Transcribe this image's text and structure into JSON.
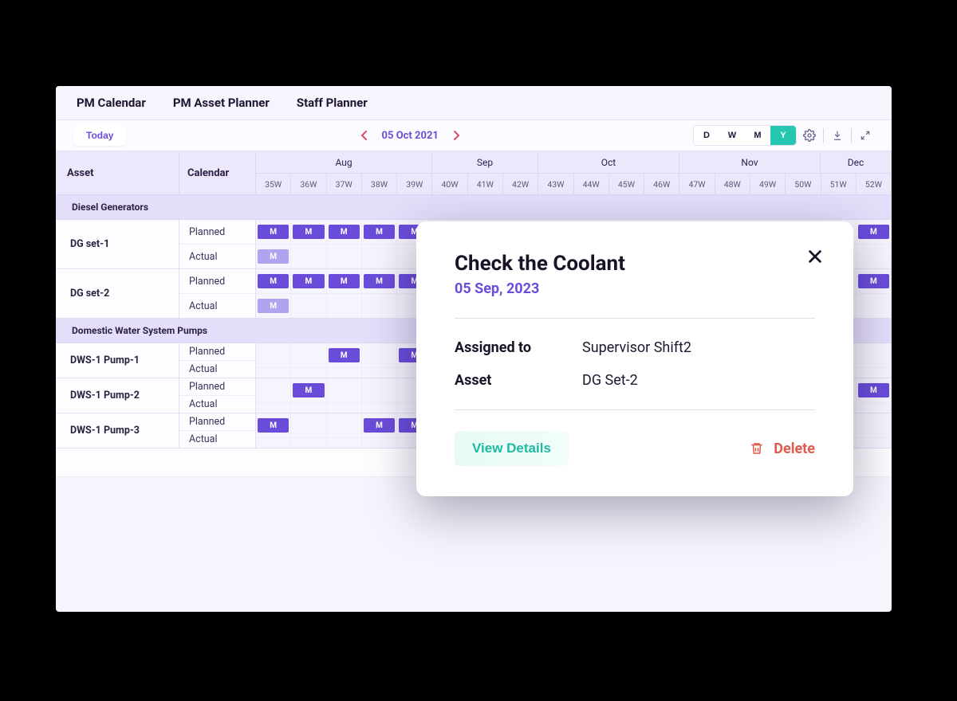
{
  "tabs": [
    {
      "label": "PM Calendar"
    },
    {
      "label": "PM Asset Planner"
    },
    {
      "label": "Staff Planner"
    }
  ],
  "toolbar": {
    "today": "Today",
    "date": "05 Oct 2021",
    "view_d": "D",
    "view_w": "W",
    "view_m": "M",
    "view_y": "Y"
  },
  "header": {
    "asset": "Asset",
    "calendar": "Calendar",
    "months": [
      "Aug",
      "Sep",
      "Oct",
      "Nov",
      "Dec"
    ],
    "weeks": [
      "35W",
      "36W",
      "37W",
      "38W",
      "39W",
      "40W",
      "41W",
      "42W",
      "43W",
      "44W",
      "45W",
      "46W",
      "47W",
      "48W",
      "49W",
      "50W",
      "51W",
      "52W"
    ]
  },
  "chip_label": "M",
  "line_labels": {
    "planned": "Planned",
    "actual": "Actual"
  },
  "groups": [
    {
      "name": "Diesel Generators",
      "assets": [
        {
          "name": "DG set-1",
          "planned": [
            0,
            1,
            2,
            3,
            4,
            17
          ],
          "actual": [
            0
          ]
        },
        {
          "name": "DG set-2",
          "planned": [
            0,
            1,
            2,
            3,
            4,
            17
          ],
          "actual": [
            0
          ]
        }
      ]
    },
    {
      "name": "Domestic Water System Pumps",
      "assets": [
        {
          "name": "DWS-1 Pump-1",
          "planned": [
            2,
            4
          ],
          "actual": []
        },
        {
          "name": "DWS-1 Pump-2",
          "planned": [
            1,
            17
          ],
          "actual": []
        },
        {
          "name": "DWS-1 Pump-3",
          "planned": [
            0,
            3,
            4
          ],
          "actual": []
        }
      ]
    }
  ],
  "popover": {
    "title": "Check the Coolant",
    "date": "05 Sep, 2023",
    "assigned_label": "Assigned to",
    "assigned_value": "Supervisor Shift2",
    "asset_label": "Asset",
    "asset_value": "DG Set-2",
    "view_details": "View Details",
    "delete": "Delete"
  }
}
